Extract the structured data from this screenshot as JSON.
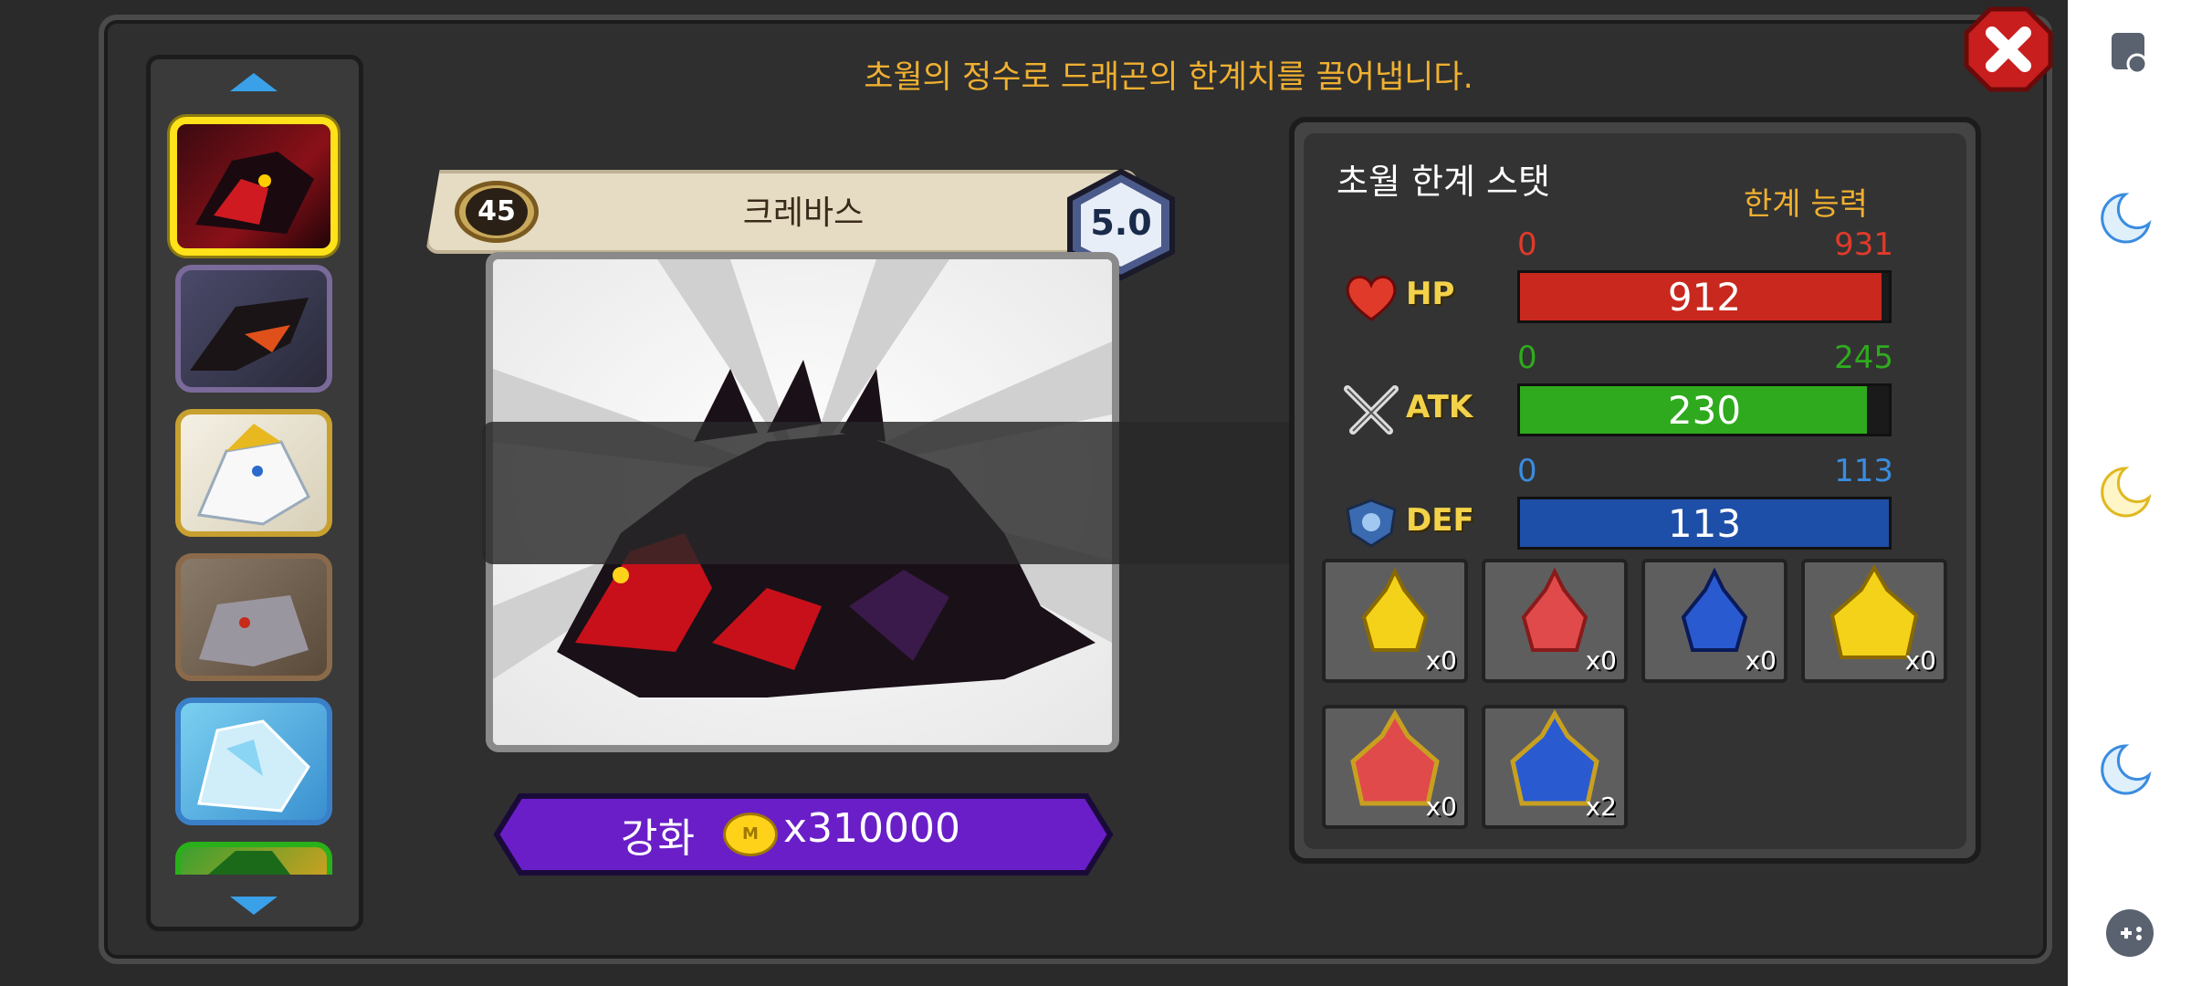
{
  "header": {
    "title": "초월의 정수로 드래곤의 한계치를 끌어냅니다."
  },
  "dragon": {
    "level": "45",
    "name": "크레바스",
    "grade": "5.0"
  },
  "enhance": {
    "label": "강화",
    "coin_letter": "M",
    "cost": "x310000"
  },
  "stats_panel": {
    "title": "초월 한계 스탯",
    "limit_label": "한계 능력",
    "stats": [
      {
        "name": "HP",
        "min": "0",
        "max": "931",
        "value": "912",
        "fill": 0.98,
        "color": "#c8281e",
        "range_color": "#e03a2a"
      },
      {
        "name": "ATK",
        "min": "0",
        "max": "245",
        "value": "230",
        "fill": 0.94,
        "color": "#2faa1e",
        "range_color": "#2faa1e"
      },
      {
        "name": "DEF",
        "min": "0",
        "max": "113",
        "value": "113",
        "fill": 1.0,
        "color": "#1e4fa8",
        "range_color": "#3a8ce0"
      }
    ]
  },
  "items": [
    {
      "name": "yellow-potion",
      "count": "x0"
    },
    {
      "name": "red-potion",
      "count": "x0"
    },
    {
      "name": "blue-potion",
      "count": "x0"
    },
    {
      "name": "large-yellow-potion",
      "count": "x0"
    },
    {
      "name": "large-red-potion",
      "count": "x0"
    },
    {
      "name": "large-blue-potion",
      "count": "x2"
    }
  ],
  "dragon_list": [
    {
      "name": "red-black-dragon",
      "selected": true
    },
    {
      "name": "dark-dragon"
    },
    {
      "name": "white-gold-dragon"
    },
    {
      "name": "gray-dragon"
    },
    {
      "name": "ice-dragon"
    },
    {
      "name": "green-dragon"
    }
  ],
  "colors": {
    "accent": "#f0b030",
    "enhance": "#6a1ec8",
    "selected_border": "#ffe21a"
  }
}
